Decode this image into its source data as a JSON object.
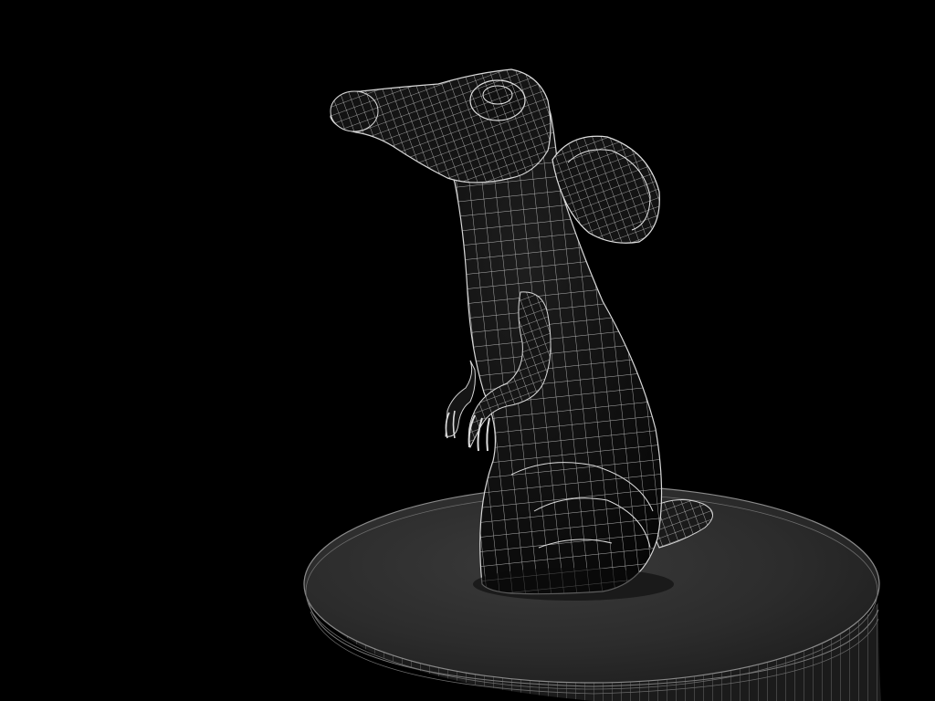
{
  "scene": {
    "subject": "rat",
    "render_style": "wireframe-over-shaded",
    "colors": {
      "background": "#000000",
      "mesh_fill": "#161616",
      "wire": "#d8d8d8",
      "pedestal_top": "#2e2e2e",
      "pedestal_side": "#1c1c1c"
    }
  }
}
